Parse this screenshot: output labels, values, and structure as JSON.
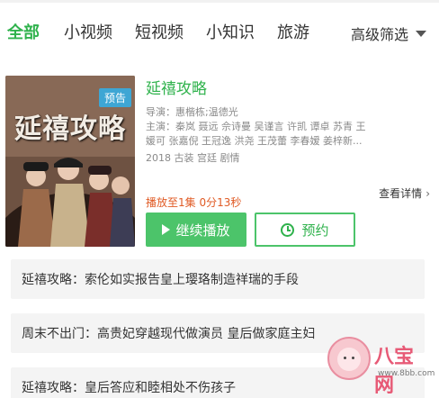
{
  "tabs": {
    "items": [
      "全部",
      "小视频",
      "短视频",
      "小知识",
      "旅游"
    ],
    "active_index": 0
  },
  "filter": {
    "label": "高级筛选",
    "icon": "caret-down-icon"
  },
  "show": {
    "badge": "预告",
    "poster_title": "延禧攻略",
    "title": "延禧攻略",
    "director": "导演：惠楷栋;温德光",
    "cast_line1": "主演：秦岚  聂远  佘诗曼  吴谨言  许凯  谭卓  苏青  王",
    "cast_line2": "媛可  张嘉倪  王冠逸  洪尧  王茂蕾  李春嫒  姜梓新...",
    "tags": "2018  古装  宫廷  剧情",
    "progress": "播放至1集 0分13秒",
    "detail_link": "查看详情",
    "play_button": "继续播放",
    "reserve_button": "预约"
  },
  "news": [
    "延禧攻略：索伦如实报告皇上璎珞制造祥瑞的手段",
    "周末不出门：高贵妃穿越现代做演员 皇后做家庭主妇",
    "延禧攻略：皇后答应和睦相处不伤孩子"
  ],
  "watermark": {
    "name": "八宝网",
    "url": "www.8bb.com"
  },
  "colors": {
    "accent": "#2fb24c",
    "badge": "#3ea6d4",
    "progress": "#e05a24"
  }
}
